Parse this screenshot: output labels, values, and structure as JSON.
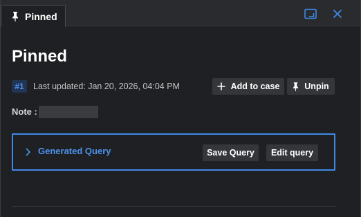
{
  "tab": {
    "label": "Pinned",
    "icon": "pin-icon"
  },
  "window_controls": {
    "expand_icon": "expand-icon",
    "close_icon": "close-icon",
    "accent": "#3f8ae6"
  },
  "page": {
    "title": "Pinned"
  },
  "meta": {
    "badge": "#1",
    "last_updated": "Last updated: Jan 20, 2026, 04:04 PM"
  },
  "actions": {
    "add_to_case": "Add to case",
    "unpin": "Unpin"
  },
  "note": {
    "label": "Note :",
    "value_redacted": true
  },
  "query": {
    "label": "Generated Query",
    "expanded": false,
    "save_label": "Save Query",
    "edit_label": "Edit query"
  },
  "colors": {
    "background": "#1f2023",
    "accent_blue": "#3f8ae6",
    "button_bg": "#35363a"
  }
}
